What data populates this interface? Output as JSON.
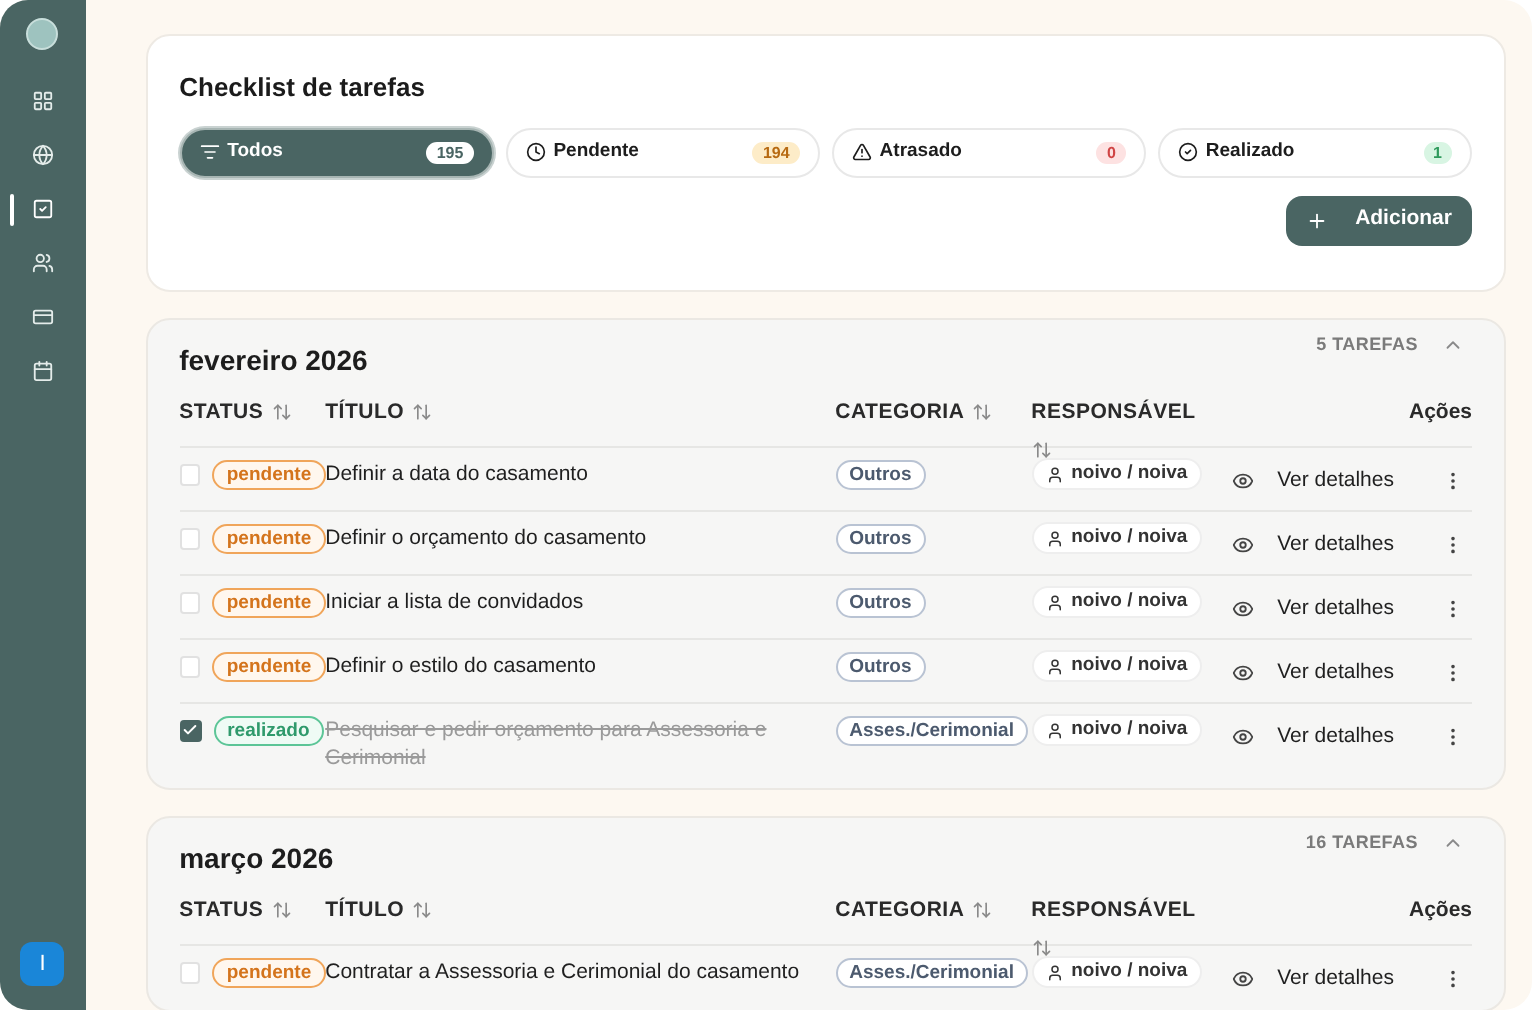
{
  "sidebar": {
    "items": [
      {
        "selected": false
      },
      {
        "selected": false
      },
      {
        "selected": true
      },
      {
        "selected": false
      },
      {
        "selected": false
      },
      {
        "selected": false
      }
    ],
    "avatar": "I"
  },
  "header": {
    "title": "Checklist de tarefas",
    "filters": [
      {
        "label": "Todos",
        "count": "195",
        "selected": true
      },
      {
        "label": "Pendente",
        "count": "194",
        "selected": false
      },
      {
        "label": "Atrasado",
        "count": "0",
        "selected": false
      },
      {
        "label": "Realizado",
        "count": "1",
        "selected": false
      }
    ],
    "add_button": "Adicionar"
  },
  "groups": [
    {
      "title": "fevereiro 2026",
      "count": "5 TAREFAS",
      "expanded": true,
      "columns": [
        {
          "label": "STATUS",
          "sortable": true
        },
        {
          "label": "TÍTULO",
          "sortable": true
        },
        {
          "label": "CATEGORIA",
          "sortable": true
        },
        {
          "label": "RESPONSÁVEL",
          "sortable": true
        },
        {
          "label": "Ações",
          "sortable": false
        }
      ],
      "rows": [
        {
          "checked": false,
          "status": "pendente",
          "title": "Definir a data do casamento",
          "category": "Outros",
          "assignee": "noivo / noiva",
          "action": "Ver detalhes"
        },
        {
          "checked": false,
          "status": "pendente",
          "title": "Definir o orçamento do casamento",
          "category": "Outros",
          "assignee": "noivo / noiva",
          "action": "Ver detalhes"
        },
        {
          "checked": false,
          "status": "pendente",
          "title": "Iniciar a lista de convidados",
          "category": "Outros",
          "assignee": "noivo / noiva",
          "action": "Ver detalhes"
        },
        {
          "checked": false,
          "status": "pendente",
          "title": "Definir o estilo do casamento",
          "category": "Outros",
          "assignee": "noivo / noiva",
          "action": "Ver detalhes"
        },
        {
          "checked": true,
          "status": "realizado",
          "title": "Pesquisar e pedir orçamento para Assessoria e Cerimonial",
          "category": "Asses./Cerimonial",
          "assignee": "noivo / noiva",
          "action": "Ver detalhes"
        }
      ]
    },
    {
      "title": "março 2026",
      "count": "16 TAREFAS",
      "expanded": true,
      "columns": [
        {
          "label": "STATUS",
          "sortable": true
        },
        {
          "label": "TÍTULO",
          "sortable": true
        },
        {
          "label": "CATEGORIA",
          "sortable": true
        },
        {
          "label": "RESPONSÁVEL",
          "sortable": true
        },
        {
          "label": "Ações",
          "sortable": false
        }
      ],
      "rows": [
        {
          "checked": false,
          "status": "pendente",
          "title": "Contratar a Assessoria e Cerimonial do casamento",
          "category": "Asses./Cerimonial",
          "assignee": "noivo / noiva",
          "action": "Ver detalhes"
        }
      ]
    }
  ]
}
